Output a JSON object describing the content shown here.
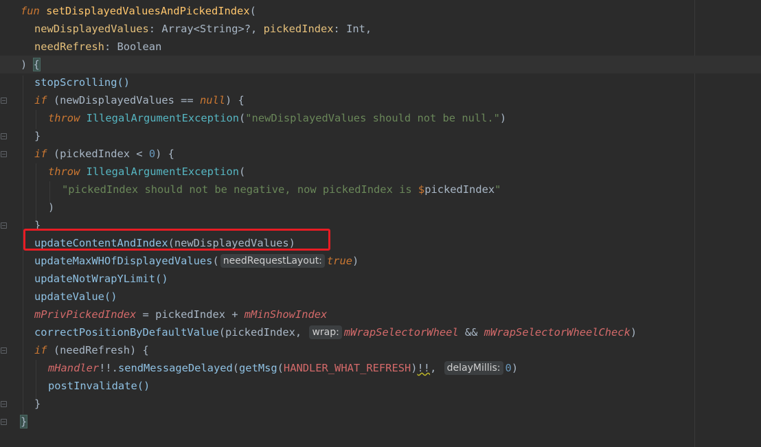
{
  "code": {
    "l1_kw": "fun",
    "l1_fn": " setDisplayedValuesAndPickedIndex",
    "l1_p": "(",
    "l2_a": "newDisplayedValues",
    "l2_b": ": Array<String>?, ",
    "l2_c": "pickedIndex",
    "l2_d": ": Int,",
    "l3_a": "needRefresh",
    "l3_b": ": Boolean",
    "l4_a": ") ",
    "l4_b": "{",
    "l5": "stopScrolling()",
    "l6_kw": "if",
    "l6_a": " (newDisplayedValues == ",
    "l6_null": "null",
    "l6_b": ") {",
    "l7_kw": "throw",
    "l7_ex": " IllegalArgumentException",
    "l7_a": "(",
    "l7_str": "\"newDisplayedValues should not be null.\"",
    "l7_b": ")",
    "l8": "}",
    "l9_kw": "if",
    "l9_a": " (pickedIndex < ",
    "l9_num": "0",
    "l9_b": ") {",
    "l10_kw": "throw",
    "l10_ex": " IllegalArgumentException",
    "l10_a": "(",
    "l11_str1": "\"pickedIndex should not be negative, now pickedIndex is ",
    "l11_tmpl": "$",
    "l11_var": "pickedIndex",
    "l11_str2": "\"",
    "l12": ")",
    "l13": "}",
    "l14_fn": "updateContentAndIndex",
    "l14_a": "(newDisplayedValues)",
    "l15_fn": "updateMaxWHOfDisplayedValues",
    "l15_a": "(",
    "l15_hint": "needRequestLayout:",
    "l15_true": "true",
    "l15_b": ")",
    "l16": "updateNotWrapYLimit()",
    "l17": "updateValue()",
    "l18_f1": "mPrivPickedIndex",
    "l18_a": " = pickedIndex + ",
    "l18_f2": "mMinShowIndex",
    "l19_fn": "correctPositionByDefaultValue",
    "l19_a": "(pickedIndex, ",
    "l19_hint": "wrap:",
    "l19_f1": "mWrapSelectorWheel",
    "l19_op": " && ",
    "l19_f2": "mWrapSelectorWheelCheck",
    "l19_b": ")",
    "l20_kw": "if",
    "l20_a": " (needRefresh) {",
    "l21_f": "mHandler",
    "l21_a": "!!.",
    "l21_fn": "sendMessageDelayed",
    "l21_b": "(",
    "l21_fn2": "getMsg",
    "l21_c": "(",
    "l21_const": "HANDLER_WHAT_REFRESH",
    "l21_d": ")",
    "l21_warn": "!!",
    "l21_e": ", ",
    "l21_hint": "delayMillis:",
    "l21_num": "0",
    "l21_f2": ")",
    "l22": "postInvalidate()",
    "l23": "}",
    "l24": "}"
  }
}
